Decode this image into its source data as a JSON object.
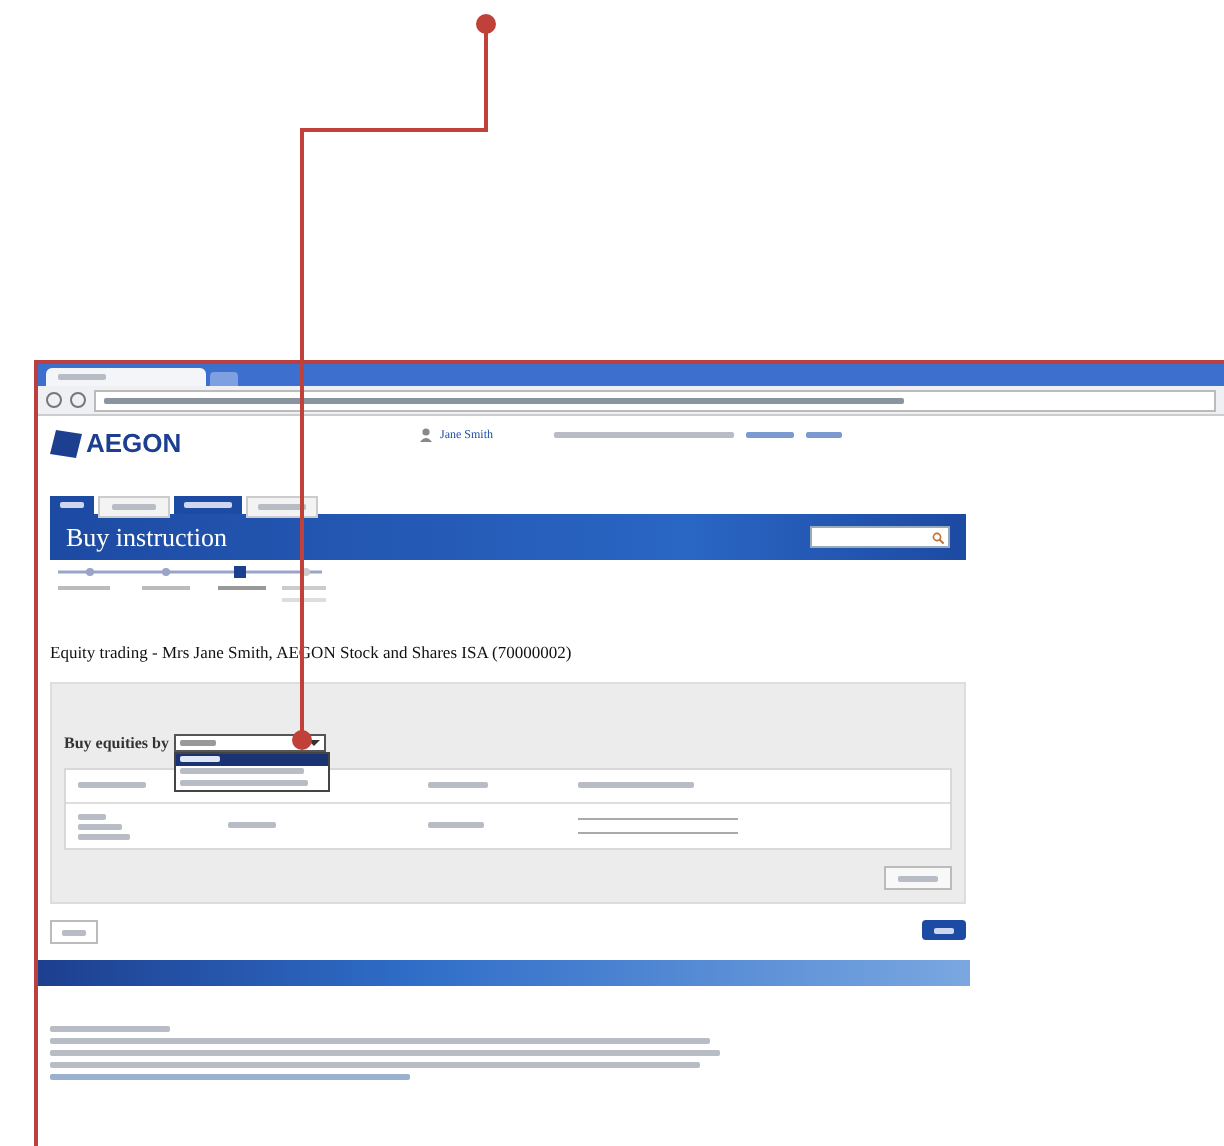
{
  "logo": "AEGON",
  "user": {
    "name": "Jane Smith"
  },
  "banner": {
    "title": "Buy instruction"
  },
  "account_title": "Equity trading - Mrs Jane Smith, AEGON Stock and Shares ISA (70000002)",
  "panel": {
    "label": "Buy equities by",
    "dropdown_options": [
      {
        "selected": true
      },
      {
        "selected": false
      },
      {
        "selected": false
      }
    ]
  }
}
